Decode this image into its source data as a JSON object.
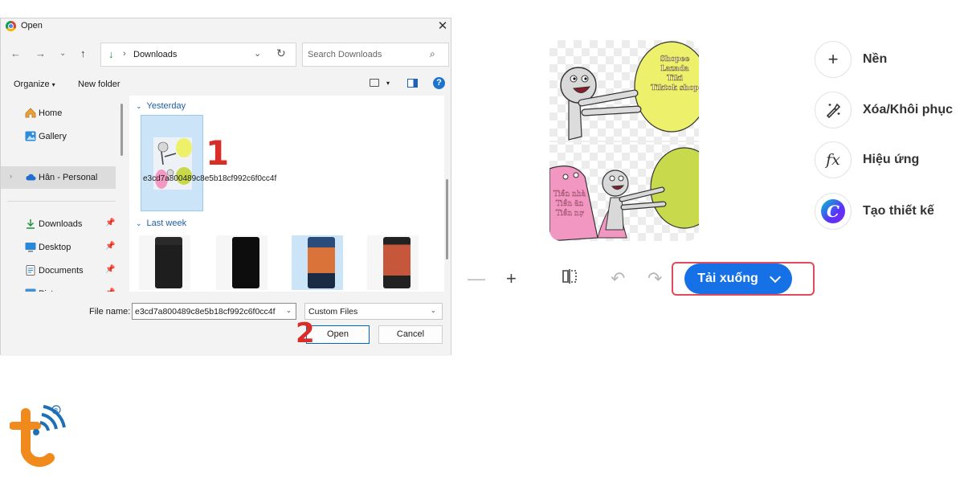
{
  "dialog": {
    "title": "Open",
    "close_glyph": "✕",
    "address": {
      "separator": "›",
      "current_folder": "Downloads"
    },
    "search_placeholder": "Search Downloads",
    "toolbar": {
      "organize_label": "Organize",
      "new_folder_label": "New folder"
    },
    "help_glyph": "?",
    "sidebar": {
      "items": [
        {
          "label": "Home",
          "icon": "home-icon"
        },
        {
          "label": "Gallery",
          "icon": "gallery-icon"
        },
        {
          "label": "Hân - Personal",
          "icon": "cloud-icon"
        },
        {
          "label": "Downloads",
          "icon": "download-icon",
          "pinned": true
        },
        {
          "label": "Desktop",
          "icon": "desktop-icon",
          "pinned": true
        },
        {
          "label": "Documents",
          "icon": "documents-icon",
          "pinned": true
        },
        {
          "label": "Pictures",
          "icon": "pictures-icon",
          "pinned": true
        }
      ]
    },
    "files": {
      "groups": [
        {
          "label": "Yesterday"
        },
        {
          "label": "Last week"
        }
      ],
      "selected_file_name": "e3cd7a800489c8e5b18cf992c6f0cc4f"
    },
    "footer": {
      "file_name_label": "File name:",
      "file_name_value": "e3cd7a800489c8e5b18cf992c6f0cc4f",
      "file_type": "Custom Files",
      "open_label": "Open",
      "cancel_label": "Cancel"
    }
  },
  "annotations": {
    "step1": "1",
    "step2": "2"
  },
  "preview": {
    "bubble_text_lines": [
      "Shopee",
      "Lazada",
      "Tiki",
      "Tiktok shop"
    ],
    "pink_text_lines": [
      "Tiền nhà",
      "Tiền ăn",
      "Tiền nợ"
    ]
  },
  "editor": {
    "tools": [
      {
        "label": "Nền",
        "icon": "plus-icon"
      },
      {
        "label": "Xóa/Khôi phục",
        "icon": "magic-brush-icon"
      },
      {
        "label": "Hiệu ứng",
        "icon": "fx-icon"
      },
      {
        "label": "Tạo thiết kế",
        "icon": "canva-logo-icon"
      }
    ],
    "fx_glyph": "fx",
    "canva_glyph": "C",
    "download_label": "Tải xuống"
  },
  "colors": {
    "accent_blue": "#1670e6",
    "highlight_red": "#e04a5a",
    "annotation_red": "#d92d27",
    "brand_orange": "#f08a1d",
    "brand_blue": "#1f6fb5"
  }
}
